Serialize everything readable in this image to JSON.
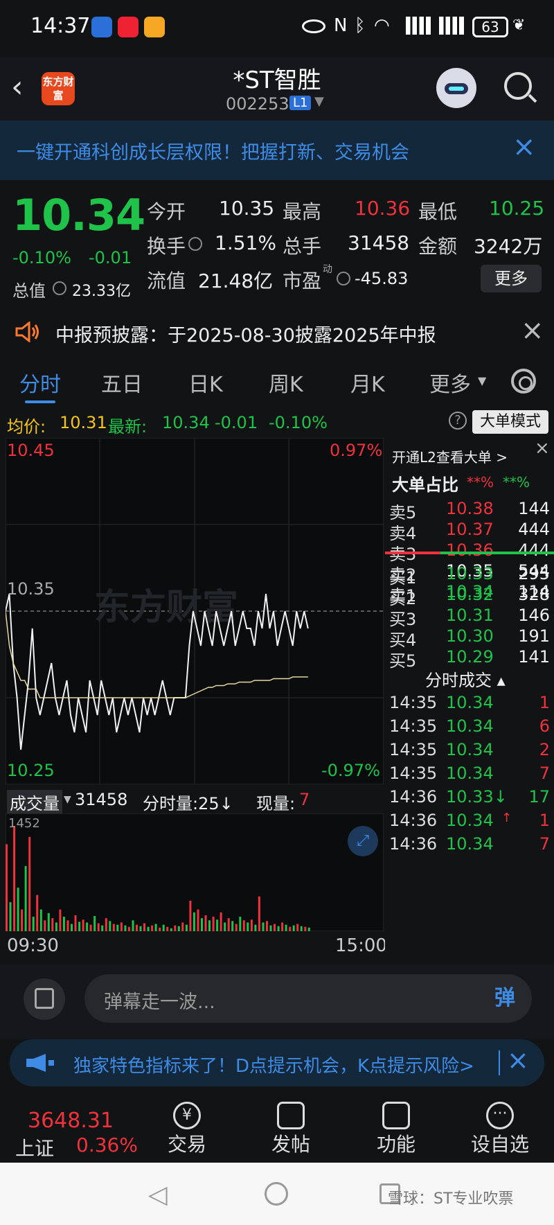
{
  "status": {
    "time": "14:37",
    "battery": "63"
  },
  "header": {
    "logo": "东方财富",
    "title": "*ST智胜",
    "code": "002253",
    "level": "L1"
  },
  "banner": {
    "text": "一键开通科创成长层权限！把握打新、交易机会"
  },
  "quote": {
    "price": "10.34",
    "change_pct": "-0.10%",
    "change": "-0.01",
    "open_label": "今开",
    "open": "10.35",
    "high_label": "最高",
    "high": "10.36",
    "low_label": "最低",
    "low": "10.25",
    "turnover_label": "换手",
    "turnover": "1.51%",
    "volume_label": "总手",
    "volume": "31458",
    "amount_label": "金额",
    "amount": "3242万",
    "mktcap_label": "总值",
    "mktcap": "23.33亿",
    "float_label": "流值",
    "float": "21.48亿",
    "pe_label": "市盈",
    "pe_sup": "动",
    "pe": "-45.83",
    "more": "更多"
  },
  "notice": {
    "text": "中报预披露：于2025-08-30披露2025年中报"
  },
  "tabs": [
    "分时",
    "五日",
    "日K",
    "周K",
    "月K",
    "更多"
  ],
  "info": {
    "avg_label": "均价:",
    "avg": "10.31",
    "last_label": "最新:",
    "last": "10.34",
    "chg": "-0.01",
    "pct": "-0.10%",
    "mode": "大单模式"
  },
  "chart": {
    "top_price": "10.45",
    "top_pct": "0.97%",
    "bottom_price": "10.25",
    "bottom_pct": "-0.97%",
    "ref_price": "10.35",
    "watermark": "东方财富",
    "vol_label": "成交量",
    "vol_value": "31458",
    "fen_label": "分时量:25↓",
    "now_label": "现量:",
    "now_value": "7",
    "vol_max": "1452",
    "time_start": "09:30",
    "time_end": "15:00"
  },
  "chart_data": {
    "type": "line",
    "ylim": [
      10.25,
      10.45
    ],
    "series": [
      {
        "name": "price",
        "values": [
          10.35,
          10.36,
          10.32,
          10.3,
          10.27,
          10.29,
          10.31,
          10.34,
          10.3,
          10.29,
          10.3,
          10.31,
          10.32,
          10.3,
          10.29,
          10.3,
          10.31,
          10.29,
          10.28,
          10.3,
          10.29,
          10.28,
          10.31,
          10.3,
          10.29,
          10.31,
          10.3,
          10.29,
          10.3,
          10.28,
          10.29,
          10.3,
          10.29,
          10.3,
          10.29,
          10.28,
          10.3,
          10.29,
          10.3,
          10.29,
          10.3,
          10.31,
          10.3,
          10.29,
          10.3,
          10.3,
          10.3,
          10.3,
          10.33,
          10.35,
          10.34,
          10.33,
          10.35,
          10.34,
          10.33,
          10.35,
          10.34,
          10.33,
          10.34,
          10.35,
          10.33,
          10.34,
          10.35,
          10.34,
          10.34,
          10.33,
          10.35,
          10.34,
          10.36,
          10.34,
          10.35,
          10.33,
          10.34,
          10.35,
          10.34,
          10.33,
          10.35,
          10.34,
          10.35,
          10.34
        ]
      },
      {
        "name": "avg",
        "values": [
          10.35,
          10.33,
          10.32,
          10.315,
          10.31,
          10.31,
          10.305,
          10.305,
          10.305,
          10.3,
          10.3,
          10.3,
          10.3,
          10.3,
          10.3,
          10.3,
          10.3,
          10.3,
          10.3,
          10.3,
          10.3,
          10.3,
          10.3,
          10.3,
          10.3,
          10.3,
          10.3,
          10.3,
          10.3,
          10.3,
          10.3,
          10.3,
          10.3,
          10.3,
          10.3,
          10.3,
          10.3,
          10.3,
          10.3,
          10.3,
          10.3,
          10.3,
          10.3,
          10.3,
          10.3,
          10.3,
          10.3,
          10.3,
          10.301,
          10.302,
          10.303,
          10.304,
          10.305,
          10.306,
          10.306,
          10.307,
          10.307,
          10.307,
          10.308,
          10.308,
          10.308,
          10.309,
          10.309,
          10.309,
          10.309,
          10.31,
          10.31,
          10.31,
          10.31,
          10.31,
          10.311,
          10.311,
          10.311,
          10.311,
          10.311,
          10.312,
          10.312,
          10.312,
          10.312,
          10.312
        ]
      }
    ],
    "volume": [
      1200,
      400,
      1452,
      600,
      300,
      900,
      1300,
      200,
      500,
      300,
      150,
      250,
      180,
      120,
      300,
      200,
      150,
      100,
      220,
      130,
      160,
      120,
      90,
      210,
      110,
      80,
      180,
      140,
      100,
      90,
      120,
      80,
      60,
      150,
      90,
      70,
      110,
      60,
      80,
      100,
      50,
      90,
      60,
      40,
      80,
      70,
      120,
      90,
      420,
      260,
      300,
      180,
      220,
      150,
      200,
      160,
      260,
      120,
      180,
      140,
      100,
      200,
      150,
      120,
      160,
      90,
      480,
      120,
      140,
      80,
      100,
      70,
      120,
      90,
      60,
      80,
      100,
      70,
      60,
      50
    ],
    "volume_colors": [
      "r",
      "g",
      "r",
      "g",
      "r",
      "g",
      "r",
      "g",
      "r",
      "g",
      "r",
      "g",
      "r",
      "g",
      "r",
      "g",
      "r",
      "g",
      "r",
      "g",
      "r",
      "g",
      "r",
      "g",
      "r",
      "g",
      "r",
      "g",
      "r",
      "g",
      "r",
      "g",
      "r",
      "g",
      "r",
      "g",
      "r",
      "g",
      "r",
      "g",
      "r",
      "g",
      "r",
      "g",
      "r",
      "g",
      "r",
      "g",
      "r",
      "g",
      "r",
      "g",
      "r",
      "g",
      "r",
      "g",
      "r",
      "g",
      "r",
      "g",
      "r",
      "g",
      "r",
      "g",
      "r",
      "g",
      "r",
      "g",
      "r",
      "g",
      "r",
      "g",
      "r",
      "g",
      "r",
      "g",
      "r",
      "g",
      "r",
      "g"
    ]
  },
  "orderbook": {
    "link": "开通L2查看大单 >",
    "big_label": "大单占比",
    "big_red": "**%",
    "big_green": "**%",
    "sells": [
      {
        "label": "卖5",
        "price": "10.38",
        "vol": "144",
        "color": "#f0323c"
      },
      {
        "label": "卖4",
        "price": "10.37",
        "vol": "444",
        "color": "#f0323c"
      },
      {
        "label": "卖3",
        "price": "10.36",
        "vol": "444",
        "color": "#f0323c"
      },
      {
        "label": "卖2",
        "price": "10.35",
        "vol": "544",
        "color": "#ededed"
      },
      {
        "label": "卖1",
        "price": "10.34",
        "vol": "114",
        "color": "#1fc34a"
      }
    ],
    "buys": [
      {
        "label": "买1",
        "price": "10.33",
        "vol": "295",
        "color": "#1fc34a"
      },
      {
        "label": "买2",
        "price": "10.32",
        "vol": "328",
        "color": "#1fc34a"
      },
      {
        "label": "买3",
        "price": "10.31",
        "vol": "146",
        "color": "#1fc34a"
      },
      {
        "label": "买4",
        "price": "10.30",
        "vol": "191",
        "color": "#1fc34a"
      },
      {
        "label": "买5",
        "price": "10.29",
        "vol": "141",
        "color": "#1fc34a"
      }
    ],
    "ticks_label": "分时成交 ▴",
    "ticks": [
      {
        "time": "14:35",
        "price": "10.34",
        "vol": "1",
        "arrow": ""
      },
      {
        "time": "14:35",
        "price": "10.34",
        "vol": "6",
        "arrow": ""
      },
      {
        "time": "14:35",
        "price": "10.34",
        "vol": "2",
        "arrow": ""
      },
      {
        "time": "14:35",
        "price": "10.34",
        "vol": "7",
        "arrow": ""
      },
      {
        "time": "14:36",
        "price": "10.33↓",
        "vol": "17",
        "arrow": ""
      },
      {
        "time": "14:36",
        "price": "10.34",
        "vol": "1",
        "arrow": "↑"
      },
      {
        "time": "14:36",
        "price": "10.34",
        "vol": "7",
        "arrow": ""
      }
    ]
  },
  "comment": {
    "placeholder": "弹幕走一波...",
    "send": "弹"
  },
  "promo": {
    "text": "独家特色指标来了！D点提示机会，K点提示风险>"
  },
  "nav": {
    "index_value": "3648.31",
    "index_name": "上证",
    "index_pct": "0.36%",
    "items": [
      "交易",
      "发帖",
      "功能",
      "设自选"
    ]
  },
  "footer_watermark": "雪球：ST专业吹票"
}
